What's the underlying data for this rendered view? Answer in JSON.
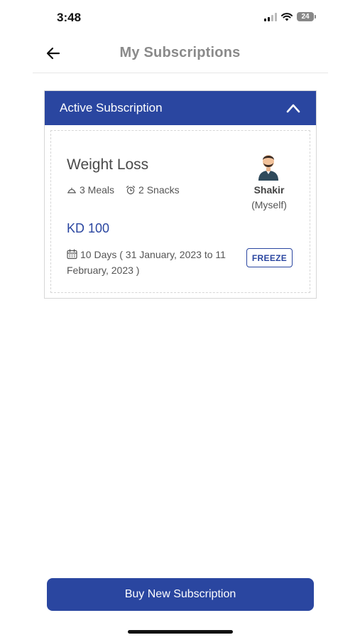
{
  "status_bar": {
    "time": "3:48",
    "battery_level": "24"
  },
  "header": {
    "title": "My Subscriptions",
    "back_icon": "arrow-left-icon"
  },
  "active_subscription": {
    "section_title": "Active Subscription",
    "collapse_icon": "chevron-up-icon",
    "plan_name": "Weight Loss",
    "meals": "3 Meals",
    "snacks": "2 Snacks",
    "price": "KD 100",
    "duration": "10 Days ( 31 January, 2023 to 11 February, 2023 )",
    "freeze_label": "FREEZE",
    "member": {
      "name": "Shakir",
      "relation": "(Myself)"
    }
  },
  "footer": {
    "buy_label": "Buy New Subscription"
  },
  "colors": {
    "primary": "#2a46a0",
    "title_gray": "#8a8a8a",
    "text": "#4a4a4a"
  }
}
